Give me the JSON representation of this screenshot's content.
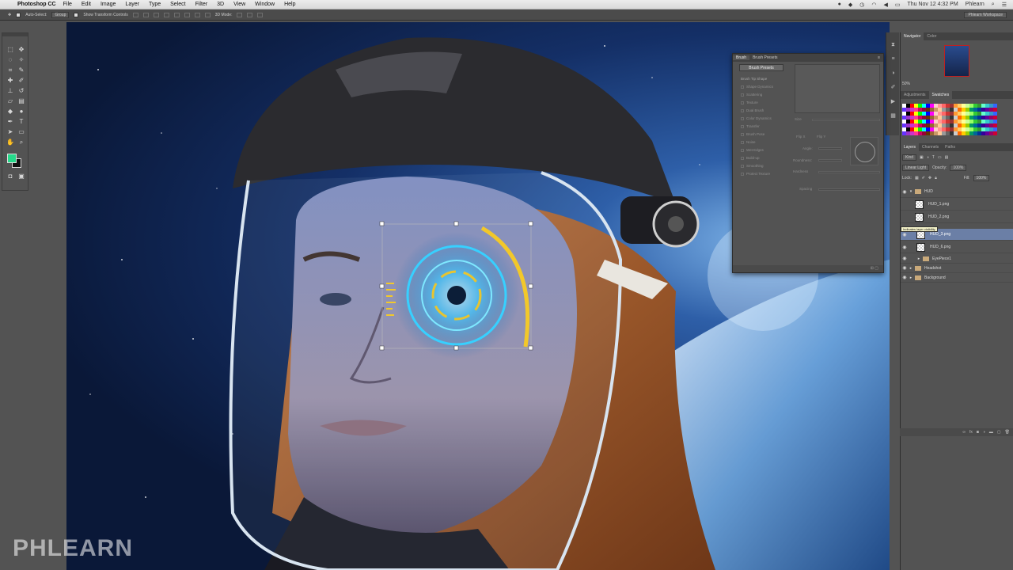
{
  "app": {
    "name": "Photoshop CC",
    "menu": [
      "File",
      "Edit",
      "Image",
      "Layer",
      "Type",
      "Select",
      "Filter",
      "3D",
      "View",
      "Window",
      "Help"
    ],
    "clock": "Thu Nov 12  4:32 PM",
    "user": "Phlearn"
  },
  "options_bar": {
    "auto_select_label": "Auto-Select:",
    "auto_select_value": "Group",
    "transform_label": "Show Transform Controls",
    "mode_3d_label": "3D Mode:",
    "workspace": "Phlearn Workspace"
  },
  "brush_panel": {
    "tabs": [
      "Brush",
      "Brush Presets"
    ],
    "presets_button": "Brush Presets",
    "options": [
      "Brush Tip Shape",
      "Shape Dynamics",
      "Scattering",
      "Texture",
      "Dual Brush",
      "Color Dynamics",
      "Transfer",
      "Brush Pose",
      "Noise",
      "Wet Edges",
      "Build-up",
      "Smoothing",
      "Protect Texture"
    ],
    "labels": {
      "size": "Size",
      "flip_x": "Flip X",
      "flip_y": "Flip Y",
      "angle": "Angle:",
      "roundness": "Roundness:",
      "hardness": "Hardness",
      "spacing": "Spacing"
    }
  },
  "navigator": {
    "tabs": [
      "Navigator",
      "Color"
    ],
    "zoom": "50%"
  },
  "swatches": {
    "tabs": [
      "Adjustments",
      "Swatches"
    ],
    "colors": [
      "#ffffff",
      "#000000",
      "#ff0000",
      "#ffff00",
      "#00ff00",
      "#00ffff",
      "#0000ff",
      "#ff00ff",
      "#ffcccc",
      "#ff9999",
      "#ff6666",
      "#cc3333",
      "#993333",
      "#ff9933",
      "#ffcc66",
      "#ffff99",
      "#ccff99",
      "#99ff66",
      "#33cc33",
      "#339933",
      "#66ffcc",
      "#33cccc",
      "#3399cc",
      "#3366ff",
      "#6633ff",
      "#9933cc",
      "#cc33cc",
      "#ff3399",
      "#cc0066",
      "#990033",
      "#663300",
      "#996633",
      "#cc9966",
      "#ffcc99",
      "#999999",
      "#666666",
      "#333333",
      "#cccccc",
      "#ff6600",
      "#ffcc00",
      "#99cc00",
      "#009966",
      "#006699",
      "#003399",
      "#330099",
      "#660099",
      "#990066",
      "#cc0033"
    ]
  },
  "layers": {
    "tabs": [
      "Layers",
      "Channels",
      "Paths"
    ],
    "filter": "Kind",
    "blend_mode": "Linear Light",
    "opacity_label": "Opacity:",
    "opacity": "100%",
    "lock_label": "Lock:",
    "fill_label": "Fill:",
    "fill": "100%",
    "items": [
      {
        "name": "HUD",
        "type": "group",
        "open": true
      },
      {
        "name": "HUD_1.png",
        "type": "layer"
      },
      {
        "name": "HUD_2.png",
        "type": "layer"
      },
      {
        "name": "HUD_3.png",
        "type": "layer",
        "selected": true
      },
      {
        "name": "HUD_6.png",
        "type": "layer"
      },
      {
        "name": "EyePiece1",
        "type": "group"
      },
      {
        "name": "Headshot",
        "type": "group"
      },
      {
        "name": "Background",
        "type": "group"
      }
    ],
    "tooltip": "Indicates layer visibility"
  },
  "watermark": "PHLEARN"
}
